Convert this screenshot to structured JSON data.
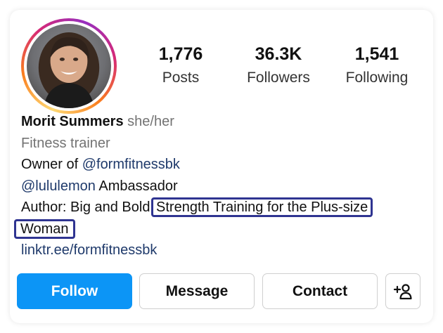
{
  "profile": {
    "avatar_icon": "profile-photo",
    "name": "Morit Summers",
    "pronouns": "she/her",
    "category": "Fitness trainer",
    "bio": {
      "line1_prefix": "Owner of ",
      "line1_link": "@formfitnessbk",
      "line2_link": "@lululemon",
      "line2_suffix": " Ambassador",
      "line3_prefix": "Author: Big and Bold:",
      "line3_highlight": "Strength Training for the Plus-size",
      "line4_highlight": "Woman",
      "website": "linktr.ee/formfitnessbk"
    }
  },
  "stats": {
    "posts_count": "1,776",
    "posts_label": "Posts",
    "followers_count": "36.3K",
    "followers_label": "Followers",
    "following_count": "1,541",
    "following_label": "Following"
  },
  "actions": {
    "follow_label": "Follow",
    "message_label": "Message",
    "contact_label": "Contact",
    "add_user_icon": "add-user-icon"
  },
  "colors": {
    "follow_button": "#0c95f6",
    "link": "#1f3a6b",
    "highlight_box": "#2f3491"
  }
}
